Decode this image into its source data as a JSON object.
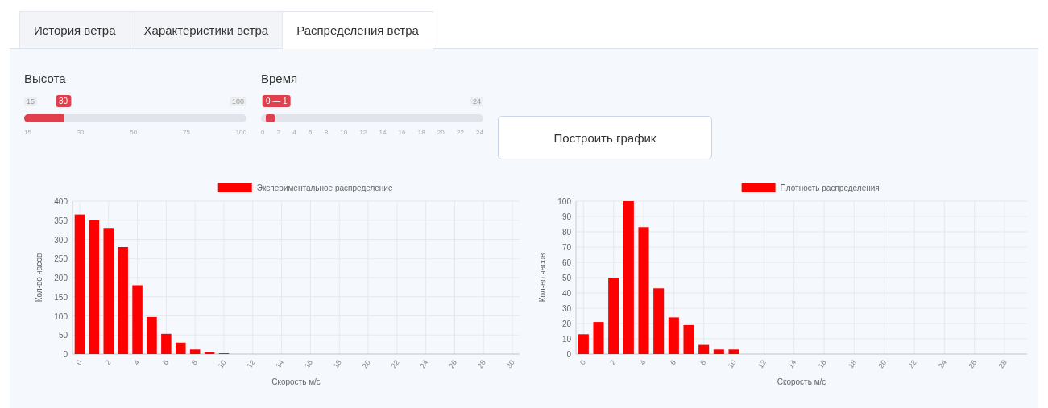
{
  "tabs": [
    {
      "label": "История ветра",
      "selected": false
    },
    {
      "label": "Характеристики ветра",
      "selected": false
    },
    {
      "label": "Распределения ветра",
      "selected": true
    }
  ],
  "sliders": [
    {
      "label": "Высота",
      "min": "15",
      "max": "100",
      "value": "30",
      "level": 0.176,
      "ticks": [
        "15",
        "30",
        "50",
        "75",
        "100"
      ]
    },
    {
      "label": "Время",
      "max": "24",
      "value": "0 — 1",
      "level": 0.042,
      "ticks": [
        "0",
        "2",
        "4",
        "6",
        "8",
        "10",
        "12",
        "14",
        "16",
        "18",
        "20",
        "22",
        "24"
      ]
    }
  ],
  "button": "Построить график",
  "charts": [
    {
      "chart_data": {
        "type": "bar",
        "xlabel": "Скорость м/с",
        "ylabel": "Кол-во часов",
        "grid": true,
        "x": [
          0,
          1,
          2,
          3,
          4,
          5,
          6,
          7,
          8,
          9,
          10
        ],
        "series": [
          {
            "name": "Экспериментальное распределение",
            "color": "#ff0000",
            "values": [
              365,
              350,
              330,
              280,
              180,
              97,
              53,
              30,
              12,
              5,
              2
            ]
          }
        ],
        "xlim": [
          -0.5,
          30.5
        ],
        "ylim": [
          0,
          400
        ],
        "xticks": [
          0,
          2,
          4,
          6,
          8,
          10,
          12,
          14,
          16,
          18,
          20,
          22,
          24,
          26,
          28,
          30
        ],
        "yticks": [
          0,
          50,
          100,
          150,
          200,
          250,
          300,
          350,
          400
        ]
      }
    },
    {
      "chart_data": {
        "type": "bar",
        "xlabel": "Скорость м/с",
        "ylabel": "Кол-во часов",
        "grid": true,
        "x": [
          0,
          1,
          2,
          3,
          4,
          5,
          6,
          7,
          8,
          9,
          10
        ],
        "series": [
          {
            "name": "Плотность распределения",
            "color": "#ff0000",
            "values": [
              13,
              21,
              50,
              100,
              83,
              43,
              24,
              19,
              6,
              3,
              3
            ]
          }
        ],
        "xlim": [
          -0.5,
          29.5
        ],
        "ylim": [
          0,
          100
        ],
        "xticks": [
          0,
          2,
          4,
          6,
          8,
          10,
          12,
          14,
          16,
          18,
          20,
          22,
          24,
          26,
          28
        ],
        "yticks": [
          0,
          10,
          20,
          30,
          40,
          50,
          60,
          70,
          80,
          90,
          100
        ]
      }
    }
  ]
}
